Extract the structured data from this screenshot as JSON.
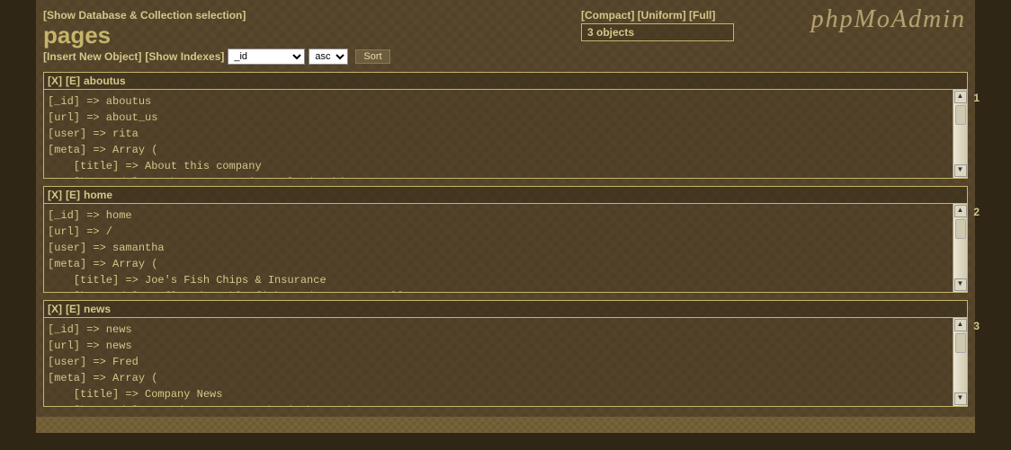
{
  "topLinks": {
    "showDbCollection": "[Show Database & Collection selection]"
  },
  "pageTitle": "pages",
  "actions": {
    "insertNew": "[Insert New Object]",
    "showIndexes": "[Show Indexes]",
    "sortLabel": "Sort"
  },
  "sortField": "_id",
  "sortOrder": "asc",
  "modes": {
    "compact": "[Compact]",
    "uniform": "[Uniform]",
    "full": "[Full]"
  },
  "countText": "3 objects",
  "logoText": "phpMoAdmin",
  "records": [
    {
      "num": "1",
      "delete": "[X]",
      "edit": "[E]",
      "name": "aboutus",
      "lines": [
        "[_id] => aboutus",
        "[url] => about_us",
        "[user] => rita",
        "[meta] => Array (",
        "    [title] => About this company"
      ],
      "cutoff": "    [keywords] => about, executives, leadership"
    },
    {
      "num": "2",
      "delete": "[X]",
      "edit": "[E]",
      "name": "home",
      "lines": [
        "[_id] => home",
        "[url] => /",
        "[user] => samantha",
        "[meta] => Array (",
        "    [title] => Joe's Fish Chips & Insurance"
      ],
      "cutoff": "    [keywords] => flounder, bluefish, red potatoes, allstate"
    },
    {
      "num": "3",
      "delete": "[X]",
      "edit": "[E]",
      "name": "news",
      "lines": [
        "[_id] => news",
        "[url] => news",
        "[user] => Fred",
        "[meta] => Array (",
        "    [title] => Company News"
      ],
      "cutoff": "    [keywords] => updates, news, what's happening"
    }
  ]
}
